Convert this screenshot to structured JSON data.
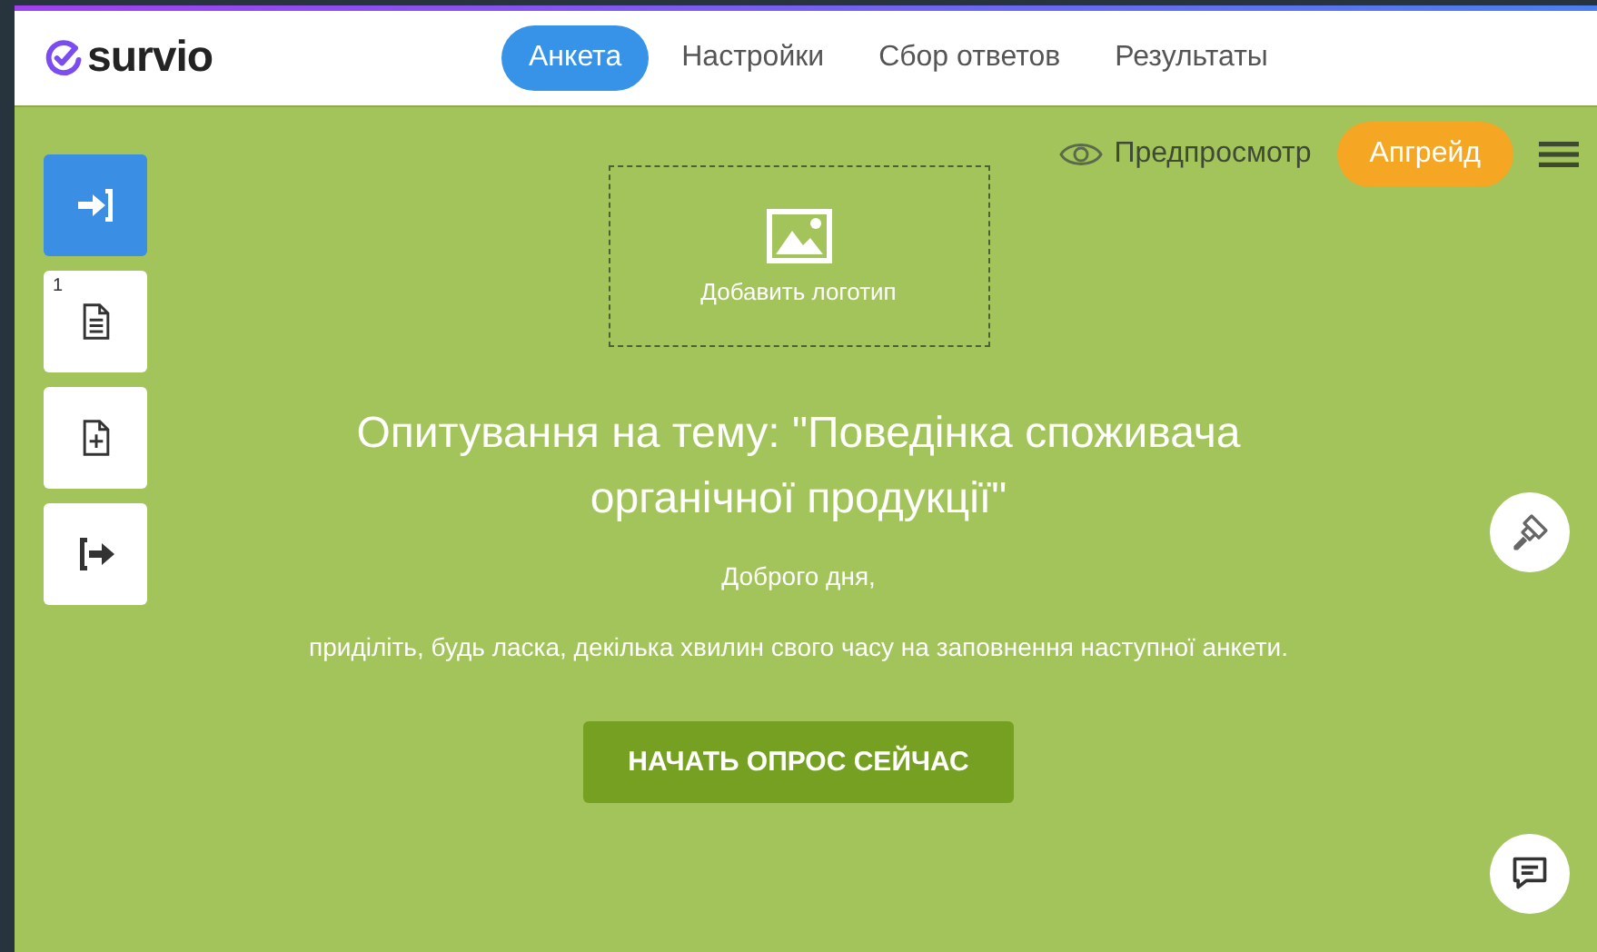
{
  "header": {
    "logo": "survio",
    "tabs": [
      {
        "label": "Анкета",
        "selected": true
      },
      {
        "label": "Настройки",
        "selected": false
      },
      {
        "label": "Сбор ответов",
        "selected": false
      },
      {
        "label": "Результаты",
        "selected": false
      }
    ]
  },
  "toolbar": {
    "preview": "Предпросмотр",
    "upgrade": "Апгрейд"
  },
  "sidebar": {
    "items": [
      {
        "kind": "start",
        "selected": true
      },
      {
        "kind": "page",
        "selected": false,
        "number": "1"
      },
      {
        "kind": "add",
        "selected": false
      },
      {
        "kind": "end",
        "selected": false
      }
    ]
  },
  "survey": {
    "logo_placeholder": "Добавить логотип",
    "title": "Опитування на тему: \"Поведінка споживача органічної продукції\"",
    "greeting": "Доброго дня,",
    "intro": "приділіть, будь ласка, декілька хвилин свого часу на заповнення наступної анкети.",
    "start_button": "НАЧАТЬ ОПРОС СЕЙЧАС"
  }
}
